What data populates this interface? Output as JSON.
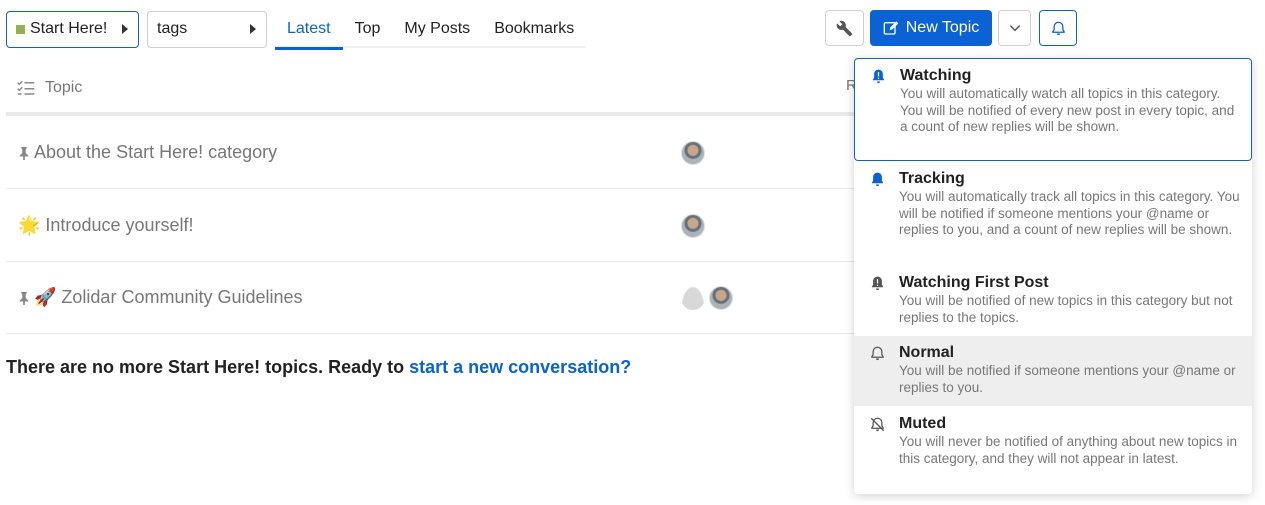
{
  "nav": {
    "category_label": "Start Here!",
    "category_color": "#8eb34f",
    "tags_label": "tags",
    "tabs": [
      {
        "label": "Latest",
        "active": true
      },
      {
        "label": "Top",
        "active": false
      },
      {
        "label": "My Posts",
        "active": false
      },
      {
        "label": "Bookmarks",
        "active": false
      }
    ]
  },
  "controls": {
    "new_topic_label": "New Topic",
    "accent": "#0a62d4",
    "icons": [
      "wrench-icon",
      "edit-icon",
      "chevron-down-icon",
      "bell-icon"
    ]
  },
  "list": {
    "header_topic": "Topic",
    "header_replies": "R",
    "topics": [
      {
        "title": "About the Start Here! category",
        "pinned": true,
        "emoji": ""
      },
      {
        "title": "Introduce yourself!",
        "pinned": false,
        "emoji": "🌟"
      },
      {
        "title": "Zolidar Community Guidelines",
        "pinned": true,
        "emoji": "🚀"
      }
    ],
    "footer_text": "There are no more Start Here! topics. Ready to ",
    "footer_link": "start a new conversation?"
  },
  "notifications": {
    "options": [
      {
        "title": "Watching",
        "desc": "You will automatically watch all topics in this category. You will be notified of every new post in every topic, and a count of new replies will be shown.",
        "state": "selected"
      },
      {
        "title": "Tracking",
        "desc": "You will automatically track all topics in this category. You will be notified if someone mentions your @name or replies to you, and a count of new replies will be shown.",
        "state": ""
      },
      {
        "title": "Watching First Post",
        "desc": "You will be notified of new topics in this category but not replies to the topics.",
        "state": ""
      },
      {
        "title": "Normal",
        "desc": "You will be notified if someone mentions your @name or replies to you.",
        "state": "hover"
      },
      {
        "title": "Muted",
        "desc": "You will never be notified of anything about new topics in this category, and they will not appear in latest.",
        "state": ""
      }
    ]
  }
}
